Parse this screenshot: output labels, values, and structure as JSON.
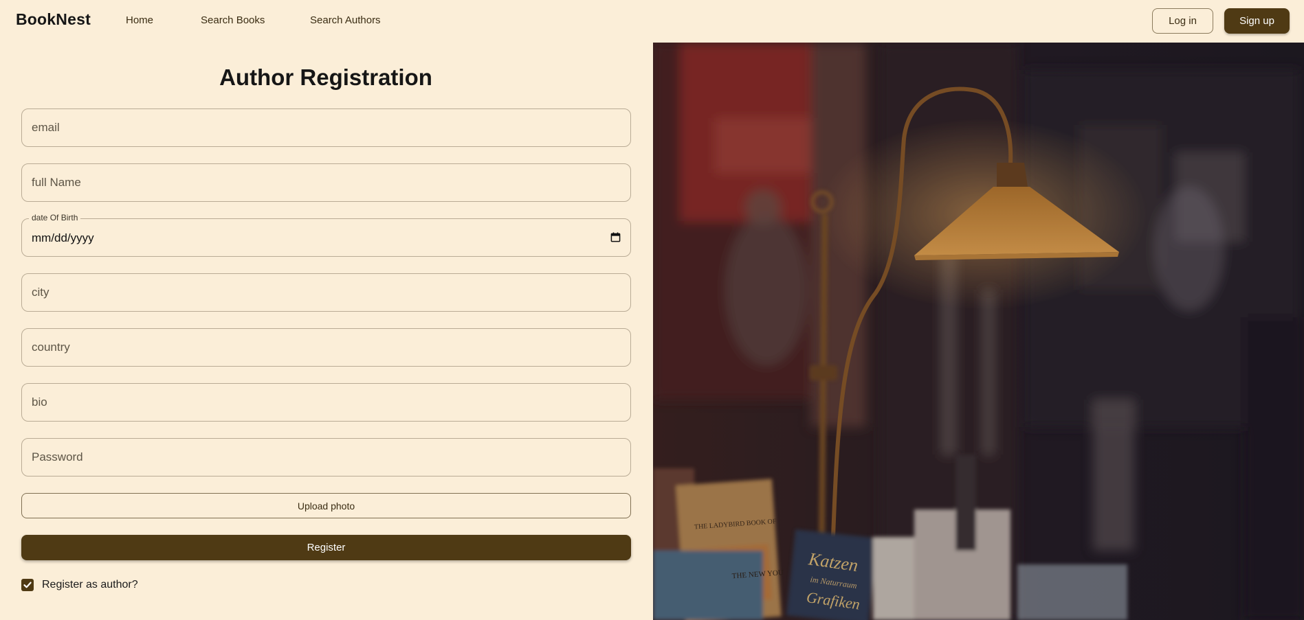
{
  "header": {
    "brand": "BookNest",
    "nav": [
      "Home",
      "Search Books",
      "Search Authors"
    ],
    "login_label": "Log in",
    "signup_label": "Sign up"
  },
  "form": {
    "title": "Author Registration",
    "email_placeholder": "email",
    "full_name_placeholder": "full Name",
    "dob_label": "date Of Birth",
    "dob_value": "mm/dd/yyyy",
    "city_placeholder": "city",
    "country_placeholder": "country",
    "bio_placeholder": "bio",
    "password_placeholder": "Password",
    "upload_label": "Upload photo",
    "register_label": "Register",
    "author_checkbox_label": "Register as author?",
    "author_checked": true
  },
  "hero_image": {
    "books": [
      "THE LADYBIRD BOOK OF",
      "THE NEW YOU",
      "Katzen",
      "im Naturraum",
      "Grafiken"
    ]
  },
  "colors": {
    "background": "#fbeed8",
    "primary": "#4f3a14",
    "border": "#b9ab95"
  }
}
